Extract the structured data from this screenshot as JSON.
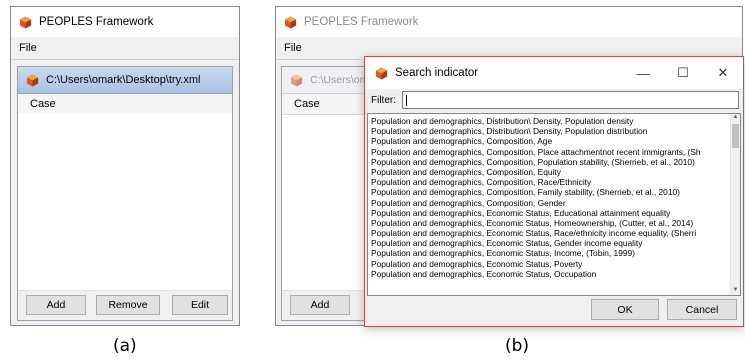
{
  "app_title": "PEOPLES Framework",
  "menu_file": "File",
  "panel_a": {
    "document_path": "C:\\Users\\omark\\Desktop\\try.xml",
    "column_header": "Case",
    "buttons": {
      "add": "Add",
      "remove": "Remove",
      "edit": "Edit"
    }
  },
  "panel_b": {
    "background_path": "C:\\Users\\oma",
    "column_header": "Case",
    "add_button": "Add"
  },
  "dialog": {
    "title": "Search indicator",
    "controls": {
      "minimize": "—",
      "maximize": "☐",
      "close": "✕"
    },
    "filter_label": "Filter:",
    "filter_value": "",
    "items": [
      "Population and demographics, Distribution\\ Density, Population density",
      "Population and demographics, Distribution\\ Density, Population distribution",
      "Population and demographics, Composition, Age",
      "Population and demographics, Composition, Place attachmentnot recent immigrants, (Sh",
      "Population and demographics, Composition, Population stability, (Sherrieb, et al., 2010)",
      "Population and demographics, Composition, Equity",
      "Population and demographics, Composition, Race/Ethnicity",
      "Population and demographics, Composition, Family stability, (Sherrieb, et al., 2010)",
      "Population and demographics, Composition, Gender",
      "Population and demographics, Economic Status, Educational attainment equality",
      "Population and demographics, Economic Status, Homeownership, (Cutter, et al., 2014)",
      "Population and demographics, Economic Status, Race/ethnicity income equality, (Sherri",
      "Population and demographics, Economic Status, Gender income equality",
      "Population and demographics, Economic Status, Income, (Tobin, 1999)",
      "Population and demographics, Economic Status, Poverty",
      "Population and demographics, Economic Status, Occupation"
    ],
    "ok": "OK",
    "cancel": "Cancel"
  },
  "captions": {
    "a": "(a)",
    "b": "(b)"
  },
  "colors": {
    "accent_border": "#c0504d",
    "active_title": "#b9cde9"
  }
}
